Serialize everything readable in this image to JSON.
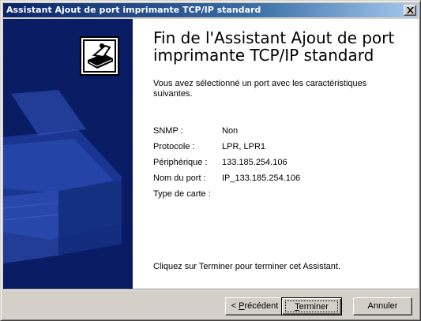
{
  "window": {
    "title": "Assistant Ajout de port imprimante TCP/IP standard"
  },
  "icons": {
    "close": "close-icon",
    "wizard": "printer-wizard-icon",
    "side_art": "printer-illustration"
  },
  "colors": {
    "titlebar_start": "#0a246a",
    "titlebar_end": "#a6caf0",
    "side_panel": "#0a1f6e",
    "dialog_face": "#d4d0c8"
  },
  "main": {
    "heading": "Fin de l'Assistant Ajout de port imprimante TCP/IP standard",
    "intro": "Vous avez sélectionné un port avec les caractéristiques suivantes.",
    "properties": [
      {
        "label": "SNMP :",
        "value": "Non"
      },
      {
        "label": "Protocole :",
        "value": "LPR, LPR1"
      },
      {
        "label": "Périphérique :",
        "value": "133.185.254.106"
      },
      {
        "label": "Nom du port :",
        "value": "IP_133.185.254.106"
      },
      {
        "label": "Type de carte :",
        "value": ""
      }
    ],
    "finish_hint": "Cliquez sur Terminer pour terminer cet Assistant."
  },
  "buttons": {
    "back_prefix": "< ",
    "back_mnemonic": "P",
    "back_rest": "récédent",
    "finish_mnemonic": "T",
    "finish_rest": "erminer",
    "cancel": "Annuler"
  }
}
